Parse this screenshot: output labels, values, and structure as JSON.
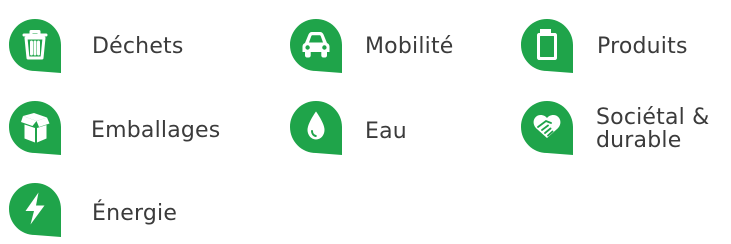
{
  "colors": {
    "badge": "#1fa44a",
    "icon": "#ffffff",
    "text": "#3b3b3b"
  },
  "categories": [
    {
      "id": "dechets",
      "label": "Déchets",
      "icon": "trash-icon"
    },
    {
      "id": "mobilite",
      "label": "Mobilité",
      "icon": "car-icon"
    },
    {
      "id": "produits",
      "label": "Produits",
      "icon": "bottle-icon"
    },
    {
      "id": "emballages",
      "label": "Emballages",
      "icon": "box-icon"
    },
    {
      "id": "eau",
      "label": "Eau",
      "icon": "water-drop-icon"
    },
    {
      "id": "societal",
      "label_line1": "Sociétal &",
      "label_line2": "durable",
      "icon": "handshake-icon"
    },
    {
      "id": "energie",
      "label": "Énergie",
      "icon": "lightning-icon"
    }
  ]
}
